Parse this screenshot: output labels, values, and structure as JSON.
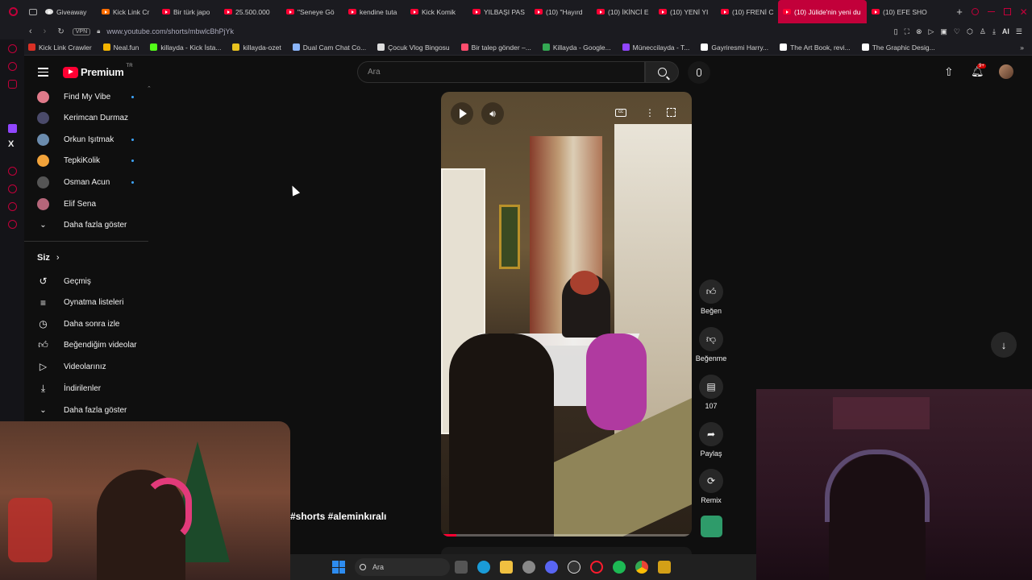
{
  "tabs": [
    {
      "label": "Giveaway",
      "active": false
    },
    {
      "label": "Kick Link Cr",
      "active": false
    },
    {
      "label": "Bir türk japo",
      "active": false
    },
    {
      "label": "25.500.000",
      "active": false
    },
    {
      "label": "\"Seneye Gö",
      "active": false
    },
    {
      "label": "kendine tuta",
      "active": false
    },
    {
      "label": "Kick Komik",
      "active": false
    },
    {
      "label": "YILBAŞI PAS",
      "active": false
    },
    {
      "label": "(10) \"Hayırd",
      "active": false
    },
    {
      "label": "(10) İKİNCİ E",
      "active": false
    },
    {
      "label": "(10) YENİ YI",
      "active": false
    },
    {
      "label": "(10) FRENİ C",
      "active": false
    },
    {
      "label": "(10) Jülide'nin yeni du",
      "active": true
    },
    {
      "label": "(10) EFE SHO",
      "active": false
    }
  ],
  "address": {
    "vpn": "VPN",
    "url": "www.youtube.com/shorts/mbwlcBhPjYk",
    "ai": "AI"
  },
  "bookmarks": [
    {
      "label": "Kick Link Crawler",
      "color": "#d93025"
    },
    {
      "label": "Neal.fun",
      "color": "#f4b400"
    },
    {
      "label": "killayda - Kick İsta...",
      "color": "#53fc18"
    },
    {
      "label": "killayda-ozet",
      "color": "#e8c21f"
    },
    {
      "label": "Dual Cam Chat Co...",
      "color": "#8ab4f8"
    },
    {
      "label": "Çocuk Vlog Bingosu",
      "color": "#dddddd"
    },
    {
      "label": "Bir talep gönder –...",
      "color": "#ff4d6d"
    },
    {
      "label": "Killayda - Google...",
      "color": "#34a853"
    },
    {
      "label": "Müneccilayda - T...",
      "color": "#9146ff"
    },
    {
      "label": "Gayriresmi Harry...",
      "color": "#ffffff"
    },
    {
      "label": "The Art Book, revi...",
      "color": "#ffffff"
    },
    {
      "label": "The Graphic Desig...",
      "color": "#ffffff"
    }
  ],
  "header": {
    "logo": "Premium",
    "logo_sup": "TR",
    "search_placeholder": "Ara",
    "notif_badge": "9+"
  },
  "sidebar": {
    "subscriptions": [
      {
        "label": "Find My Vibe",
        "new": true,
        "color": "#e07a8a"
      },
      {
        "label": "Kerimcan Durmaz",
        "new": false,
        "color": "#4a4a6a"
      },
      {
        "label": "Orkun Işıtmak",
        "new": true,
        "color": "#6b8cae"
      },
      {
        "label": "TepkiKolik",
        "new": true,
        "color": "#f2a33a"
      },
      {
        "label": "Osman Acun",
        "new": true,
        "color": "#555555"
      },
      {
        "label": "Elif Sena",
        "new": false,
        "color": "#b5667a"
      }
    ],
    "show_more_1": "Daha fazla göster",
    "you_label": "Siz",
    "you_items": [
      {
        "label": "Geçmiş",
        "icon": "history-icon"
      },
      {
        "label": "Oynatma listeleri",
        "icon": "playlists-icon"
      },
      {
        "label": "Daha sonra izle",
        "icon": "watch-later-icon"
      },
      {
        "label": "Beğendiğim videolar",
        "icon": "liked-icon"
      },
      {
        "label": "Videolarınız",
        "icon": "your-videos-icon"
      },
      {
        "label": "İndirilenler",
        "icon": "downloads-icon"
      }
    ],
    "show_more_2": "Daha fazla göster"
  },
  "video": {
    "hashtags": "#shorts #aleminkıralı"
  },
  "actions": {
    "like": "Beğen",
    "dislike": "Beğenme",
    "comments": "107",
    "share": "Paylaş",
    "remix": "Remix"
  },
  "taskbar": {
    "search_label": "Ara"
  },
  "colors": {
    "accent": "#ff0033",
    "opera": "#c2003a",
    "link": "#3ea6ff"
  }
}
